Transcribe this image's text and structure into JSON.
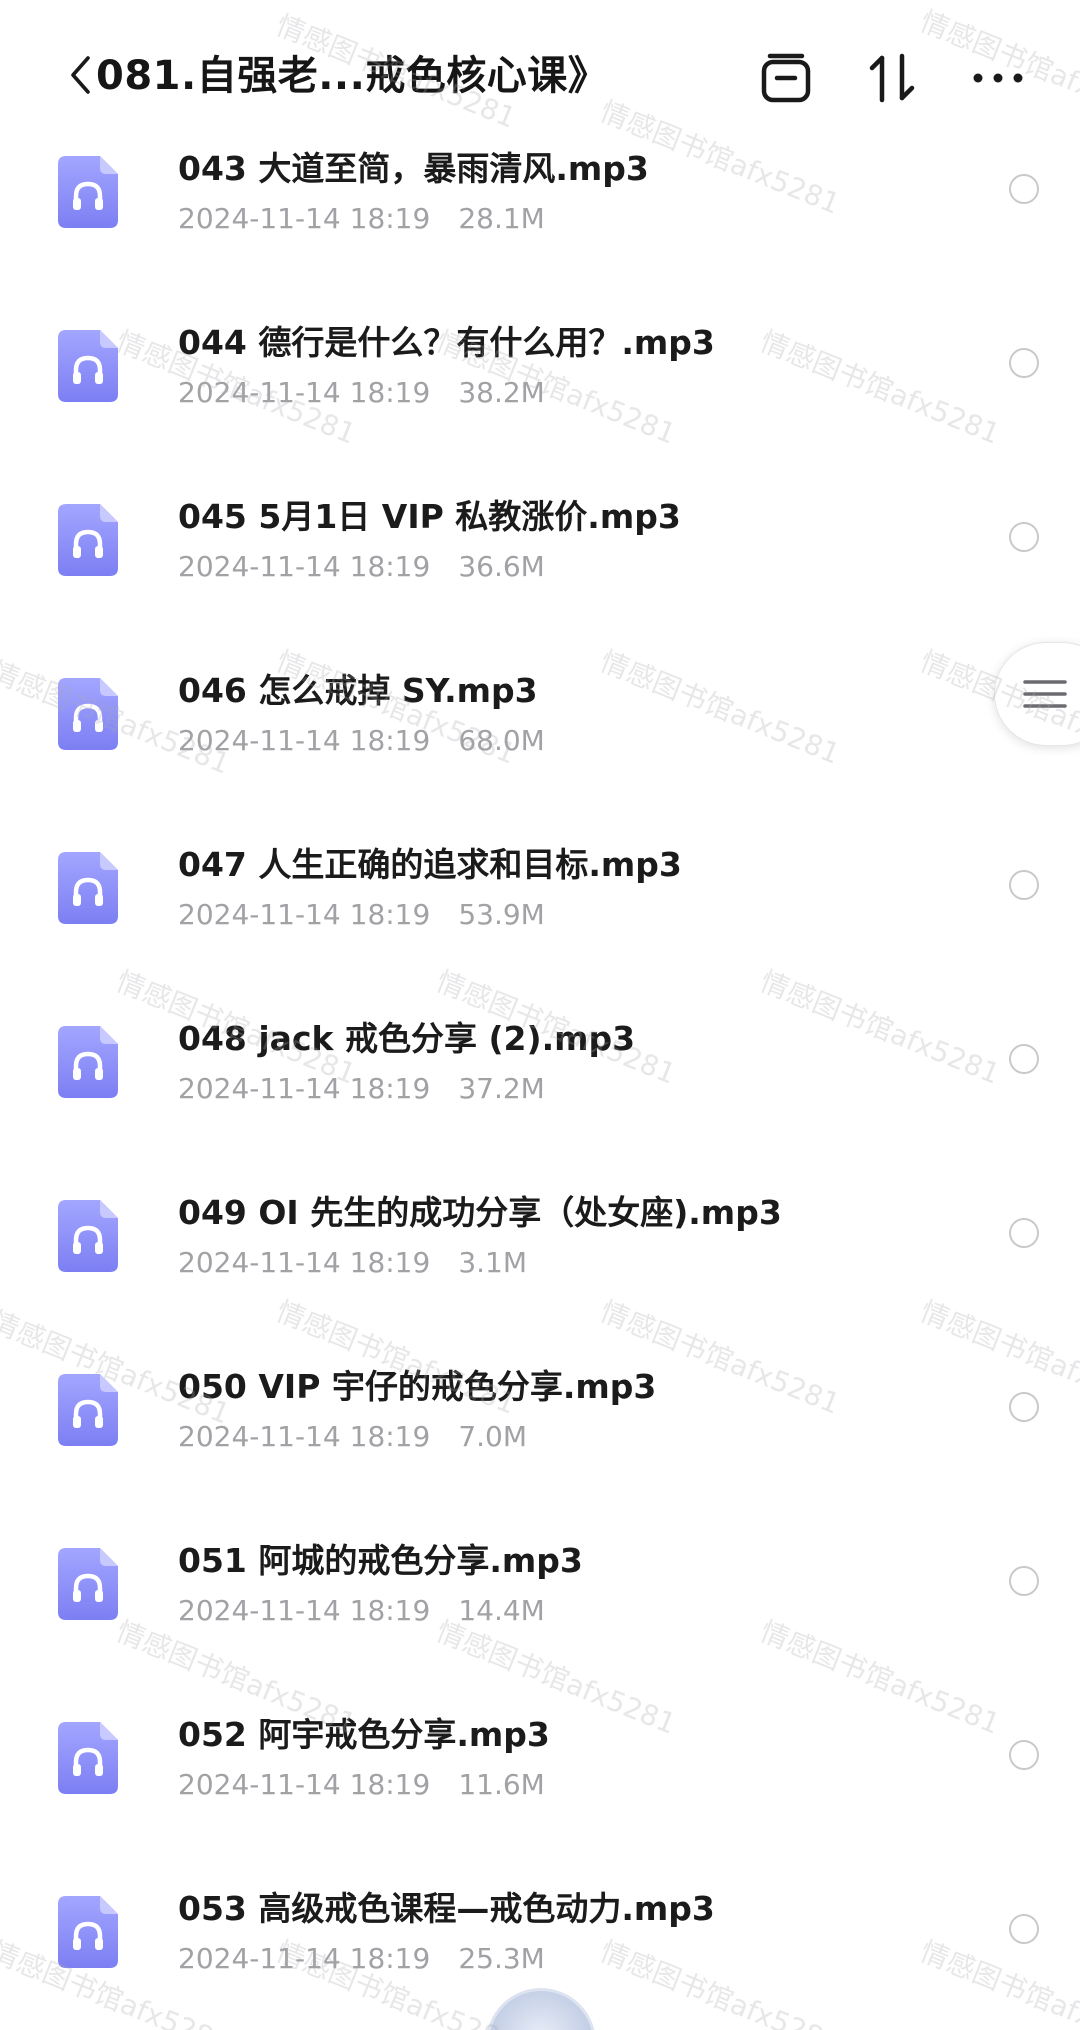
{
  "header": {
    "title": "081.自强老...戒色核心课》",
    "back_icon": "chevron-left-icon",
    "actions": [
      "doc-icon",
      "sort-icon",
      "more-icon"
    ]
  },
  "files": [
    {
      "name": "043 大道至简，暴雨清风.mp3",
      "date": "2024-11-14 18:19",
      "size": "28.1M"
    },
    {
      "name": "044 德行是什么？有什么用？.mp3",
      "date": "2024-11-14 18:19",
      "size": "38.2M"
    },
    {
      "name": "045 5月1日 VIP 私教涨价.mp3",
      "date": "2024-11-14 18:19",
      "size": "36.6M"
    },
    {
      "name": "046 怎么戒掉 SY.mp3",
      "date": "2024-11-14 18:19",
      "size": "68.0M"
    },
    {
      "name": "047 人生正确的追求和目标.mp3",
      "date": "2024-11-14 18:19",
      "size": "53.9M"
    },
    {
      "name": "048 jack 戒色分享 (2).mp3",
      "date": "2024-11-14 18:19",
      "size": "37.2M"
    },
    {
      "name": "049 OI 先生的成功分享（处女座).mp3",
      "date": "2024-11-14 18:19",
      "size": "3.1M"
    },
    {
      "name": "050 VIP 宇仔的戒色分享.mp3",
      "date": "2024-11-14 18:19",
      "size": "7.0M"
    },
    {
      "name": "051 阿城的戒色分享.mp3",
      "date": "2024-11-14 18:19",
      "size": "14.4M"
    },
    {
      "name": "052 阿宇戒色分享.mp3",
      "date": "2024-11-14 18:19",
      "size": "11.6M"
    },
    {
      "name": "053 高级戒色课程—戒色动力.mp3",
      "date": "2024-11-14 18:19",
      "size": "25.3M"
    }
  ],
  "watermark": "情感图书馆afx5281",
  "colors": {
    "icon_top": "#a3a6ff",
    "icon_bottom": "#7c7ff2",
    "meta_text": "#a2a2a6"
  }
}
